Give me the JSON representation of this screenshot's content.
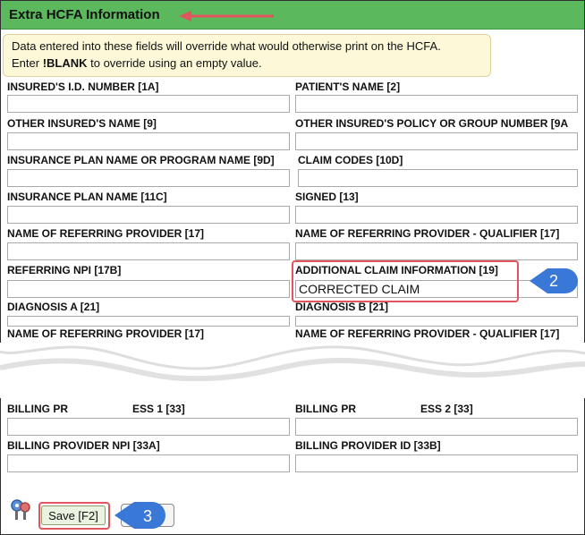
{
  "header": {
    "title": "Extra HCFA Information"
  },
  "info": {
    "line1": "Data entered into these fields will override what would otherwise print on the HCFA.",
    "line2_prefix": "Enter ",
    "line2_code": "!BLANK",
    "line2_suffix": " to override using an empty value."
  },
  "fields": {
    "insured_id": {
      "label": "INSURED'S I.D. NUMBER [1A]",
      "value": ""
    },
    "patient_name": {
      "label": "PATIENT'S NAME [2]",
      "value": ""
    },
    "other_insured_name": {
      "label": "OTHER INSURED'S NAME [9]",
      "value": ""
    },
    "other_insured_policy": {
      "label": "OTHER INSURED'S POLICY OR GROUP NUMBER [9A",
      "value": ""
    },
    "insurance_plan_9d": {
      "label": "INSURANCE PLAN NAME OR PROGRAM NAME [9D]",
      "value": ""
    },
    "claim_codes": {
      "label": "CLAIM CODES [10D]",
      "value": ""
    },
    "insurance_plan_11c": {
      "label": "INSURANCE PLAN NAME [11C]",
      "value": ""
    },
    "signed": {
      "label": "SIGNED [13]",
      "value": ""
    },
    "referring_provider": {
      "label": "NAME OF REFERRING PROVIDER [17]",
      "value": ""
    },
    "referring_provider_qualifier": {
      "label": "NAME OF REFERRING PROVIDER - QUALIFIER [17]",
      "value": ""
    },
    "referring_npi": {
      "label": "REFERRING NPI [17B]",
      "value": ""
    },
    "additional_claim_info": {
      "label": "ADDITIONAL CLAIM INFORMATION [19]",
      "value": "CORRECTED CLAIM"
    },
    "diagnosis_a": {
      "label": "DIAGNOSIS A [21]",
      "value": ""
    },
    "diagnosis_b": {
      "label": "DIAGNOSIS B [21]",
      "value": ""
    },
    "referring_provider_2": {
      "label": "NAME OF REFERRING PROVIDER [17]",
      "value": ""
    },
    "referring_provider_qualifier_2": {
      "label": "NAME OF REFERRING PROVIDER - QUALIFIER [17]",
      "value": ""
    },
    "billing_address_1": {
      "label_left": "BILLING PR",
      "label_right": "ESS 1 [33]",
      "value": ""
    },
    "billing_address_2": {
      "label_left": "BILLING PR",
      "label_right": "ESS 2 [33]",
      "value": ""
    },
    "billing_npi": {
      "label": "BILLING PROVIDER NPI [33A]",
      "value": ""
    },
    "billing_id": {
      "label": "BILLING PROVIDER ID [33B]",
      "value": ""
    }
  },
  "callouts": {
    "two": "2",
    "three": "3"
  },
  "footer": {
    "save_label": "Save [F2]",
    "keys_icon": "keys-icon"
  },
  "colors": {
    "header_bg": "#5cb85c",
    "annotation_red": "#e05560",
    "callout_blue": "#3a78d8"
  }
}
